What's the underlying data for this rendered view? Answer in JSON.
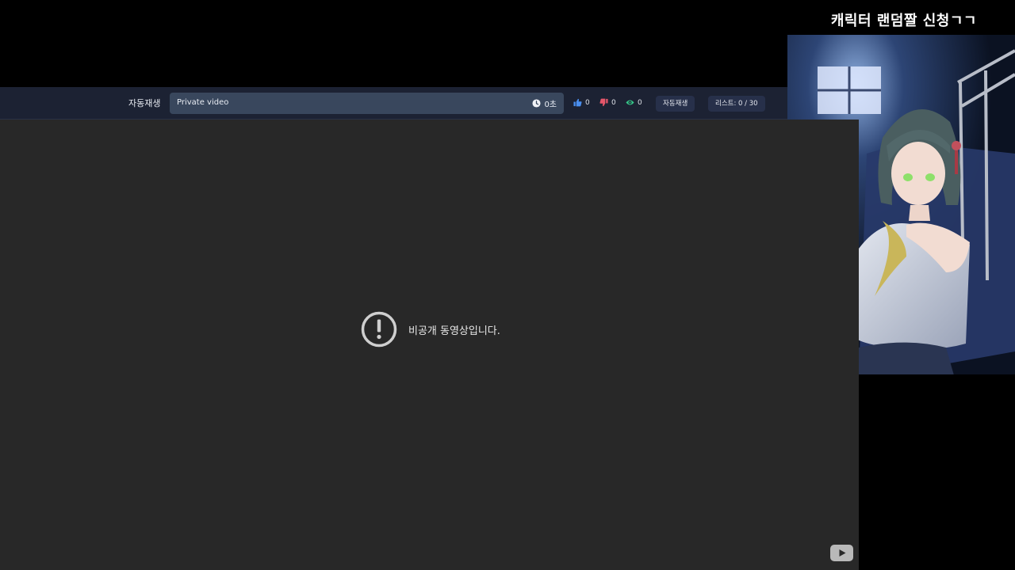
{
  "banner": {
    "title": "캐릭터 랜덤짤 신청ㄱㄱ"
  },
  "toolbar": {
    "autoplay_label": "자동재생",
    "video_title": "Private video",
    "duration": "0초",
    "likes": "0",
    "dislikes": "0",
    "views": "0",
    "autoplay_button": "자동재생",
    "list_counter": "리스트: 0 / 30"
  },
  "player": {
    "private_message": "비공개 동영상입니다."
  },
  "icons": {
    "clock": "clock-icon",
    "like": "thumbs-up-icon",
    "dislike": "thumbs-down-icon",
    "view": "eye-icon",
    "alert": "exclamation-circle-icon",
    "youtube": "youtube-logo-icon"
  },
  "colors": {
    "like": "#4a8ff0",
    "dislike": "#e5566a",
    "view": "#36c98a",
    "toolbar_bg": "#1c2233",
    "title_box_bg": "#39475d",
    "player_bg": "#282828"
  }
}
